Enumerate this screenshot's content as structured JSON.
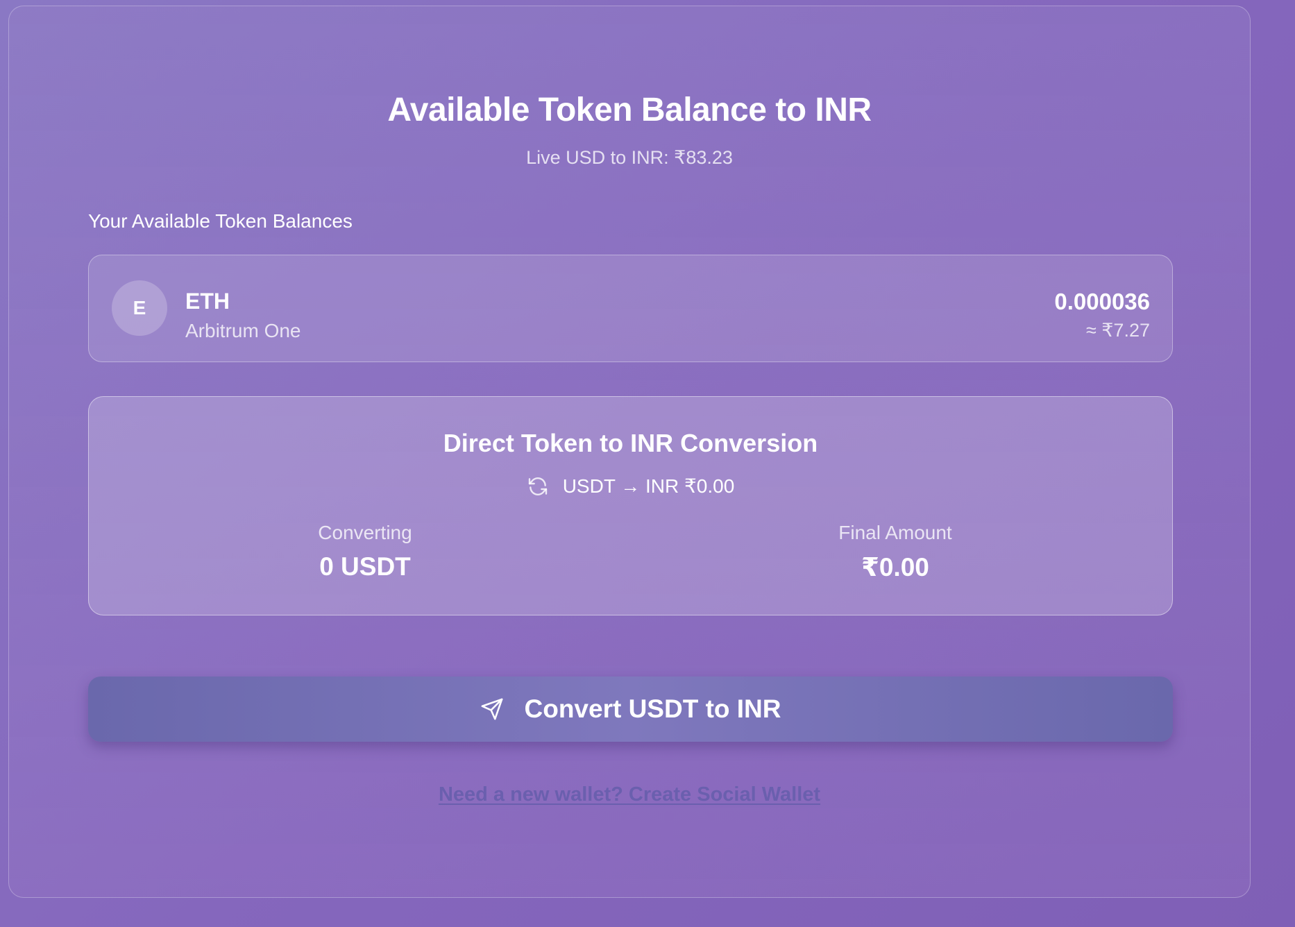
{
  "header": {
    "title": "Available Token Balance to INR",
    "subtitle": "Live USD to INR: ₹83.23"
  },
  "balances": {
    "section_label": "Your Available Token Balances",
    "tokens": [
      {
        "avatar_letter": "E",
        "symbol": "ETH",
        "network": "Arbitrum One",
        "amount": "0.000036",
        "inr_value": "≈ ₹7.27"
      }
    ]
  },
  "conversion": {
    "title": "Direct Token to INR Conversion",
    "rate_text": "USDT → INR ₹0.00",
    "rate_icon": "refresh-icon",
    "converting_label": "Converting",
    "converting_value": "0 USDT",
    "final_label": "Final Amount",
    "final_value": "₹0.00"
  },
  "actions": {
    "convert_label": "Convert USDT to INR",
    "convert_icon": "send-icon",
    "wallet_link": "Need a new wallet? Create Social Wallet"
  }
}
